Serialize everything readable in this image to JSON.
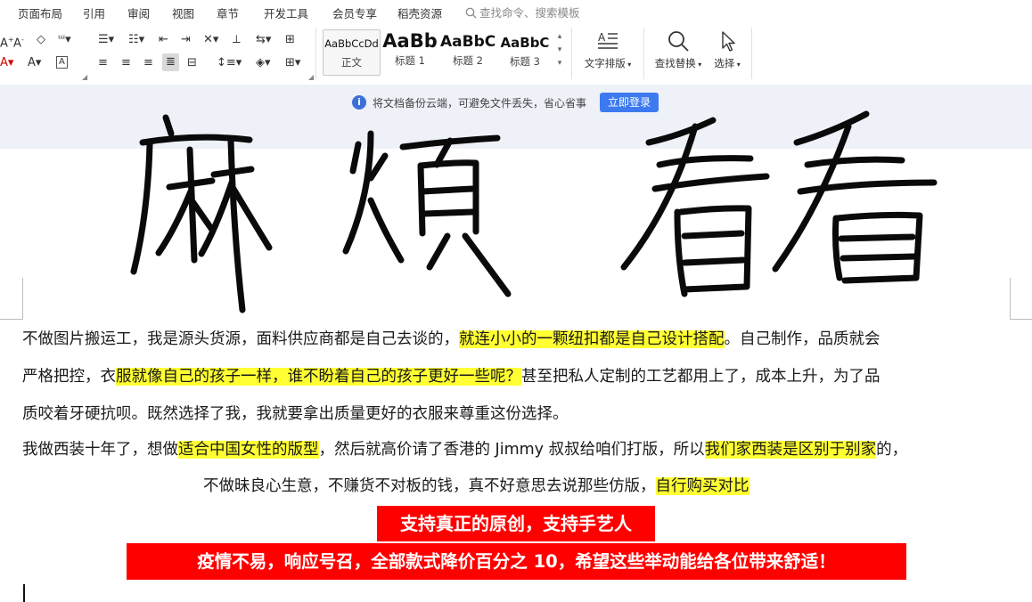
{
  "menubar": {
    "items": [
      "页面布局",
      "引用",
      "审阅",
      "视图",
      "章节",
      "开发工具",
      "会员专享",
      "稻壳资源"
    ],
    "search_placeholder": "查找命令、搜索模板"
  },
  "ribbon": {
    "styles": [
      {
        "sample": "AaBbCcDd",
        "caption": "正文"
      },
      {
        "sample": "AaBb",
        "caption": "标题 1"
      },
      {
        "sample": "AaBbC",
        "caption": "标题 2"
      },
      {
        "sample": "AaBbC",
        "caption": "标题 3"
      }
    ],
    "text_layout_label": "文字排版",
    "find_replace_label": "查找替换",
    "select_label": "选择"
  },
  "notification": {
    "text": "将文档备份云端，可避免文件丢失，省心省事",
    "button_label": "立即登录"
  },
  "document": {
    "handwriting_text": "麻烦看看",
    "line1": {
      "a": "不做图片搬运工，我是源头货源，面料供应商都是自己去谈的，",
      "hl": "就连小小的一颗纽扣都是自己设计搭配",
      "b": "。自己制作，品质就会"
    },
    "line2": {
      "a": "严格把控，衣",
      "hl": "服就像自己的孩子一样，谁不盼着自己的孩子更好一些呢？",
      "b": "甚至把私人定制的工艺都用上了，成本上升，为了品"
    },
    "line3": "质咬着牙硬抗呗。既然选择了我，我就要拿出质量更好的衣服来尊重这份选择。",
    "line4": {
      "a": "我做西装十年了，想做",
      "hl1": "适合中国女性的版型",
      "b": "，然后就高价请了香港的 Jimmy 叔叔给咱们打版，所以",
      "hl2": "我们家西装是区别于别家",
      "c": "的，"
    },
    "line5": {
      "a": "不做昧良心生意，不赚货不对板的钱，真不好意思去说那些仿版，",
      "hl": "自行购买对比"
    },
    "red1": "支持真正的原创，支持手艺人",
    "red2": "疫情不易，响应号召，全部款式降价百分之 10，希望这些举动能给各位带来舒适！"
  },
  "colors": {
    "highlight": "#ffff33",
    "red_band": "#ff0000",
    "accent_blue": "#3d7af0",
    "notif_bg": "#eef1f8"
  }
}
